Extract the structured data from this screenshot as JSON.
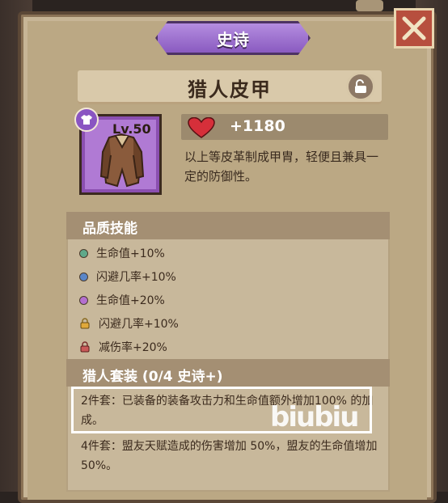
{
  "rarity": {
    "label": "史诗",
    "color": "#9b6fd0"
  },
  "item": {
    "name": "猎人皮甲",
    "level_label": "Lv.50",
    "stat_value": "+1180",
    "description": "以上等皮革制成甲胄，轻便且兼具一定的防御性。",
    "lock_icon": "unlock-icon",
    "slot_icon": "shirt-icon"
  },
  "skills": {
    "title": "品质技能",
    "items": [
      {
        "label": "生命值+10%",
        "indicator": "dot",
        "color": "#5fa98a"
      },
      {
        "label": "闪避几率+10%",
        "indicator": "dot",
        "color": "#5a86c8"
      },
      {
        "label": "生命值+20%",
        "indicator": "dot",
        "color": "#b46fd0"
      },
      {
        "label": "闪避几率+10%",
        "indicator": "lock",
        "color": "#e0a83a"
      },
      {
        "label": "减伤率+20%",
        "indicator": "lock",
        "color": "#c95a58"
      }
    ]
  },
  "set": {
    "title": "猎人套装 (0/4 史诗+)",
    "bonuses": [
      {
        "label": "2件套：",
        "text": "已装备的装备攻击力和生命值额外增加100% 的加成。"
      },
      {
        "label": "4件套：",
        "text": "盟友天赋造成的伤害增加 50%，盟友的生命值增加 50%。"
      }
    ]
  },
  "watermark": "biubiu"
}
